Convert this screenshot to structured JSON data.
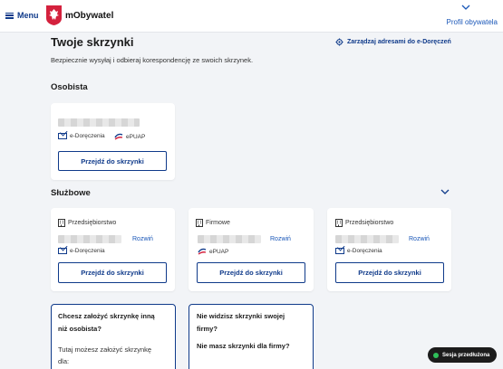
{
  "header": {
    "menu_label": "Menu",
    "app_name": "mObywatel",
    "profile_label": "Profil obywatela"
  },
  "page": {
    "title": "Twoje skrzynki",
    "subtitle": "Bezpiecznie wysyłaj i odbieraj korespondencję ze swoich skrzynek.",
    "manage_link": "Zarządzaj adresami do e-Doręczeń"
  },
  "personal": {
    "heading": "Osobista",
    "services": [
      "e-Doręczenia",
      "ePUAP"
    ],
    "button": "Przejdź do skrzynki"
  },
  "business": {
    "heading": "Służbowe",
    "cards": [
      {
        "type": "Przedsiębiorstwo",
        "expand": "Rozwiń",
        "service": "e-Doręczenia",
        "button": "Przejdź do skrzynki"
      },
      {
        "type": "Firmowe",
        "expand": "Rozwiń",
        "service": "ePUAP",
        "button": "Przejdź do skrzynki"
      },
      {
        "type": "Przedsiębiorstwo",
        "expand": "Rozwiń",
        "service": "e-Doręczenia",
        "button": "Przejdź do skrzynki"
      }
    ]
  },
  "info": [
    {
      "title_lines": [
        "Chcesz założyć skrzynkę inną",
        "niż osobista?"
      ],
      "text_lines": [
        "Tutaj możesz założyć skrzynkę",
        "dla:"
      ]
    },
    {
      "title_lines": [
        "Nie widzisz skrzynki swojej",
        "firmy?",
        "Nie masz skrzynki dla firmy?"
      ],
      "text_lines": []
    }
  ],
  "session": {
    "label": "Sesja przedłużona"
  },
  "colors": {
    "navy": "#0f3a8a",
    "link": "#1a57b8",
    "background": "#f2f4f7",
    "session_dot": "#2fbf5a"
  }
}
